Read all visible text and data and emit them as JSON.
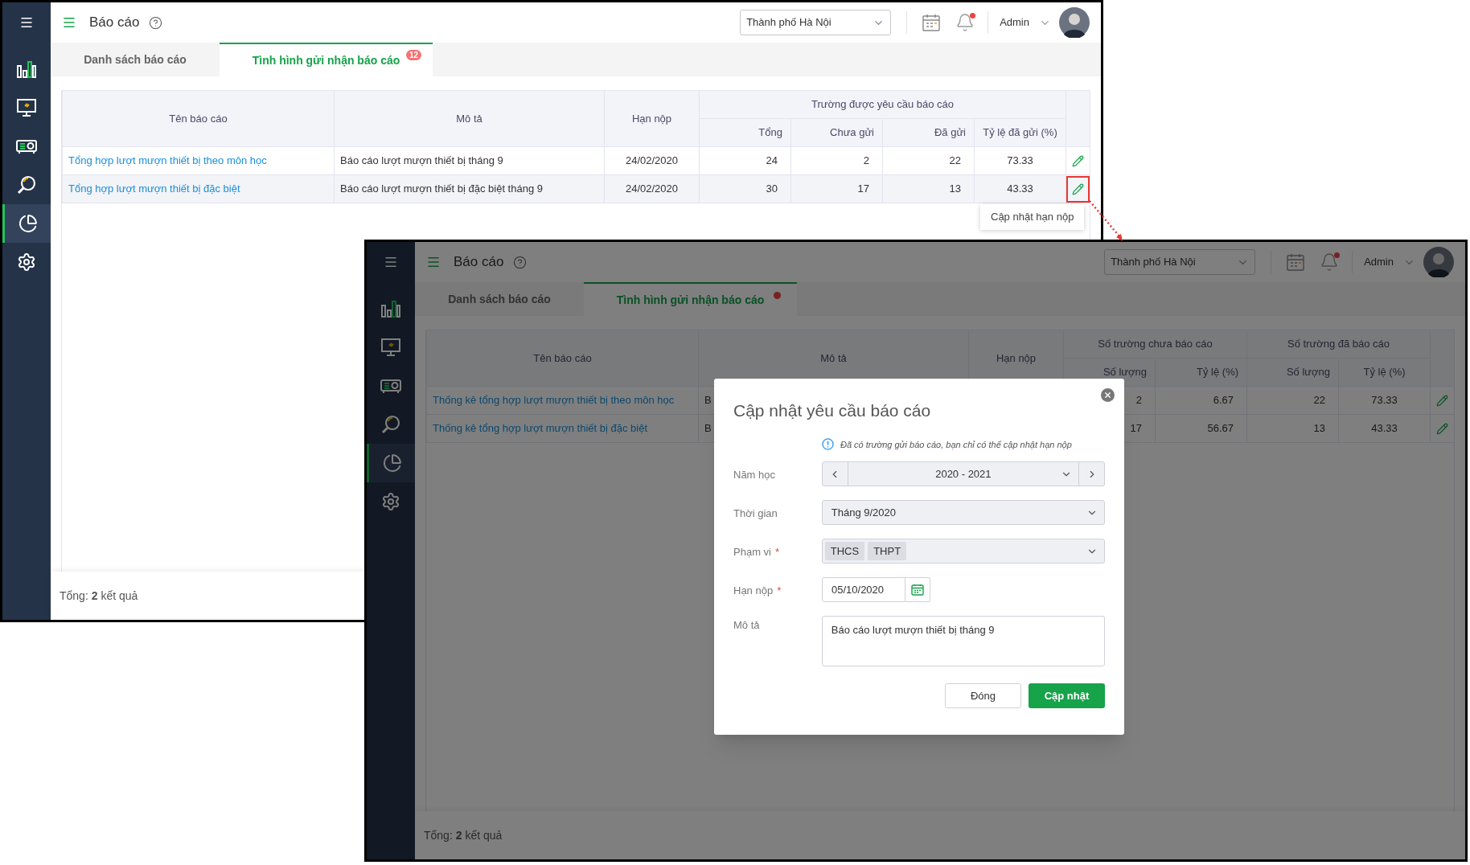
{
  "screens": [
    {
      "header": {
        "title": "Báo cáo",
        "region": "Thành phố Hà Nội",
        "user": "Admin",
        "notification_dot": true
      },
      "sidebar": {
        "items": [
          {
            "kind": "chart",
            "selected": false
          },
          {
            "kind": "monitor",
            "selected": false
          },
          {
            "kind": "projector",
            "selected": false
          },
          {
            "kind": "search",
            "selected": false
          },
          {
            "kind": "pie",
            "selected": true
          },
          {
            "kind": "settings",
            "selected": false
          }
        ]
      },
      "tabs": [
        {
          "label": "Danh sách báo cáo",
          "selected": false
        },
        {
          "label": "Tình hình gửi nhận báo cáo",
          "selected": true,
          "badge": "12"
        }
      ],
      "table": {
        "columns": [
          "Tên báo cáo",
          "Mô tả",
          "Hạn nộp"
        ],
        "column_groups": [
          {
            "label": "Trường được yêu cầu báo cáo",
            "columns": [
              "Tổng",
              "Chưa gửi",
              "Đã gửi",
              "Tỷ lệ đã gửi (%)"
            ]
          }
        ],
        "rows": [
          {
            "name": "Tổng hợp lượt mượn thiết bị theo môn học",
            "description": "Báo cáo lượt mượn thiết bị tháng 9",
            "deadline": "24/02/2020",
            "values": [
              "24",
              "2",
              "22",
              "73.33"
            ],
            "highlighted": false,
            "marked": false
          },
          {
            "name": "Tổng hợp lượt mượn thiết bị đặc biệt",
            "description": "Báo cáo lượt mượn thiết bị đặc biệt tháng 9",
            "deadline": "24/02/2020",
            "values": [
              "30",
              "17",
              "13",
              "43.33"
            ],
            "highlighted": true,
            "marked": true
          }
        ]
      },
      "tooltip": "Cập nhật hạn nộp",
      "footer": "Tổng: **2** kết quả"
    },
    {
      "header": {
        "title": "Báo cáo",
        "region": "Thành phố Hà Nội",
        "user": "Admin",
        "notification_dot": true
      },
      "sidebar": {
        "items": [
          {
            "kind": "chart",
            "selected": false
          },
          {
            "kind": "monitor",
            "selected": false
          },
          {
            "kind": "projector",
            "selected": false
          },
          {
            "kind": "search",
            "selected": false
          },
          {
            "kind": "pie",
            "selected": true
          },
          {
            "kind": "settings",
            "selected": false
          }
        ]
      },
      "tabs": [
        {
          "label": "Danh sách báo cáo",
          "selected": false
        },
        {
          "label": "Tình hình gửi nhận báo cáo",
          "selected": true,
          "dot": true
        }
      ],
      "table": {
        "columns": [
          "Tên báo cáo",
          "Mô tả",
          "Hạn nộp"
        ],
        "column_groups": [
          {
            "label": "Số trường chưa báo cáo",
            "columns": [
              "Số lượng",
              "Tỷ lệ (%)"
            ]
          },
          {
            "label": "Số trường đã báo cáo",
            "columns": [
              "Số lượng",
              "Tỷ lệ (%)"
            ]
          }
        ],
        "rows": [
          {
            "name": "Thống kê tổng hợp lượt mượn thiết bị theo môn học",
            "description": "B",
            "values": [
              "2",
              "6.67",
              "22",
              "73.33"
            ],
            "marked": false
          },
          {
            "name": "Thống kê tổng hợp lượt mượn thiết bị đặc biệt",
            "description": "B",
            "values": [
              "17",
              "56.67",
              "13",
              "43.33"
            ],
            "marked": false
          }
        ]
      },
      "footer": "Tổng: **2** kết quả",
      "modal": {
        "title": "Cập nhật yêu cầu báo cáo",
        "note": "Đã có trường gửi báo cáo, bạn chỉ có thể cập nhật hạn nộp",
        "fields": [
          {
            "kind": "stepper",
            "label": "Năm học",
            "value": "2020 - 2021",
            "disabled": true
          },
          {
            "kind": "select",
            "label": "Thời gian",
            "value": "Tháng 9/2020",
            "disabled": true
          },
          {
            "kind": "tags",
            "label": "Phạm vi",
            "required_mark": "*",
            "tags": [
              "THCS",
              "THPT"
            ],
            "disabled": true
          },
          {
            "kind": "date",
            "label": "Hạn nộp",
            "required_mark": "*",
            "value": "05/10/2020",
            "disabled": false
          },
          {
            "kind": "textarea",
            "label": "Mô tả",
            "value": "Báo cáo lượt mượn thiết bị tháng 9",
            "disabled": false
          }
        ],
        "buttons": [
          {
            "label": "Đóng",
            "kind": "secondary"
          },
          {
            "label": "Cập nhật",
            "kind": "primary"
          }
        ]
      }
    }
  ]
}
